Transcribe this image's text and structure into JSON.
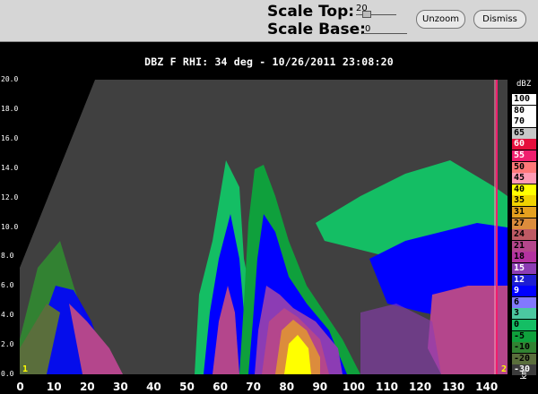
{
  "controls": {
    "scale_top_label": "Scale Top:",
    "scale_top_value": "20",
    "scale_base_label": "Scale Base:",
    "scale_base_value": "0",
    "unzoom_label": "Unzoom",
    "dismiss_label": "Dismiss"
  },
  "plot": {
    "title": "DBZ F  RHI: 34 deg  -  10/26/2011 23:08:20",
    "y_ticks": [
      "20.0",
      "18.0",
      "16.0",
      "14.0",
      "12.0",
      "10.0",
      "8.0",
      "6.0",
      "4.0",
      "2.0",
      "0.0"
    ],
    "x_ticks": [
      "0",
      "10",
      "20",
      "30",
      "40",
      "50",
      "60",
      "70",
      "80",
      "90",
      "100",
      "110",
      "120",
      "130",
      "140"
    ],
    "x_unit": "km",
    "corner_left": "1",
    "corner_right": "2"
  },
  "legend": {
    "unit": "dBZ",
    "entries": [
      {
        "label": "100",
        "color": "#ffffff",
        "text": "#000000"
      },
      {
        "label": "80",
        "color": "#ffffff",
        "text": "#000000"
      },
      {
        "label": "70",
        "color": "#ffffff",
        "text": "#000000"
      },
      {
        "label": "65",
        "color": "#c8c8c8",
        "text": "#000000"
      },
      {
        "label": "60",
        "color": "#e60f3c",
        "text": "#ffffff"
      },
      {
        "label": "55",
        "color": "#f01e6e",
        "text": "#ffffff"
      },
      {
        "label": "50",
        "color": "#ff7878",
        "text": "#000000"
      },
      {
        "label": "45",
        "color": "#ff9bb4",
        "text": "#000000"
      },
      {
        "label": "40",
        "color": "#ffff00",
        "text": "#000000"
      },
      {
        "label": "35",
        "color": "#f0d200",
        "text": "#000000"
      },
      {
        "label": "31",
        "color": "#e6a01e",
        "text": "#000000"
      },
      {
        "label": "27",
        "color": "#dc8c3c",
        "text": "#000000"
      },
      {
        "label": "24",
        "color": "#be5a64",
        "text": "#000000"
      },
      {
        "label": "21",
        "color": "#b4468c",
        "text": "#000000"
      },
      {
        "label": "18",
        "color": "#b432a0",
        "text": "#000000"
      },
      {
        "label": "15",
        "color": "#8c3cb4",
        "text": "#ffffff"
      },
      {
        "label": "12",
        "color": "#1e1ed2",
        "text": "#ffffff"
      },
      {
        "label": "9",
        "color": "#0000ff",
        "text": "#ffffff"
      },
      {
        "label": "6",
        "color": "#8278ff",
        "text": "#000000"
      },
      {
        "label": "3",
        "color": "#4bc8a0",
        "text": "#000000"
      },
      {
        "label": "0",
        "color": "#14be64",
        "text": "#000000"
      },
      {
        "label": "-5",
        "color": "#0fa03c",
        "text": "#000000"
      },
      {
        "label": "-10",
        "color": "#328232",
        "text": "#000000"
      },
      {
        "label": "-20",
        "color": "#5a6e3c",
        "text": "#000000"
      },
      {
        "label": "-30",
        "color": "#3c3c3c",
        "text": "#ffffff"
      }
    ]
  }
}
